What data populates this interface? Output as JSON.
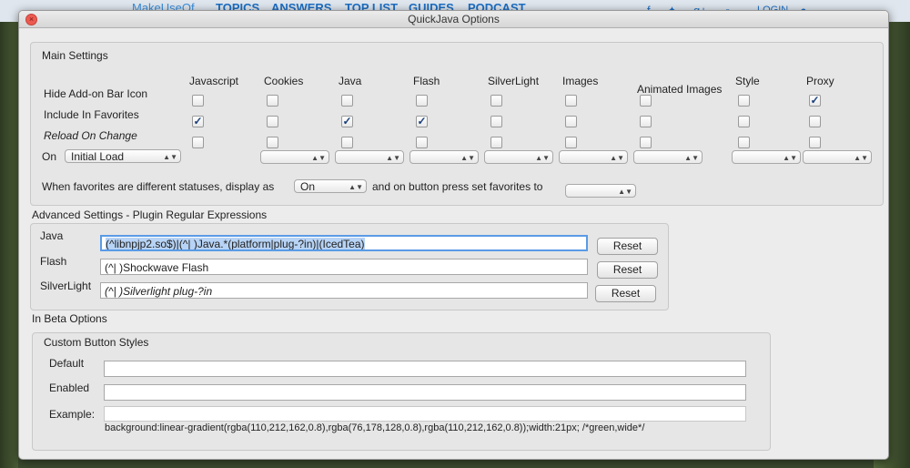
{
  "site_nav": {
    "logo": "MakeUseOf",
    "items": [
      "TOPICS",
      "ANSWERS",
      "TOP LIST",
      "GUIDES",
      "PODCAST"
    ],
    "login": "LOGIN"
  },
  "window": {
    "title": "QuickJava Options"
  },
  "main_settings": {
    "label": "Main Settings",
    "columns": [
      "Javascript",
      "Cookies",
      "Java",
      "Flash",
      "SilverLight",
      "Images",
      "Animated Images",
      "Style",
      "Proxy"
    ],
    "rows": [
      {
        "label": "Hide Add-on Bar Icon",
        "checked": [
          false,
          false,
          false,
          false,
          false,
          false,
          false,
          false,
          true
        ]
      },
      {
        "label": "Include In Favorites",
        "checked": [
          true,
          false,
          true,
          true,
          false,
          false,
          false,
          false,
          false
        ]
      },
      {
        "label": "Reload On Change",
        "checked": [
          false,
          false,
          false,
          false,
          false,
          false,
          false,
          false,
          false
        ]
      }
    ],
    "on_label": "On",
    "on_value": "Initial Load",
    "favorites_text": "When favorites are different statuses, display as",
    "favorites_value": "On",
    "button_text": "and on button press set favorites to",
    "button_value": ""
  },
  "advanced": {
    "label": "Advanced Settings - Plugin Regular Expressions",
    "rows": [
      {
        "label": "Java",
        "value": "(^libnpjp2.so$)|(^| )Java.*(platform|plug-?in)|(IcedTea)",
        "reset": "Reset"
      },
      {
        "label": "Flash",
        "value": "(^| )Shockwave Flash",
        "reset": "Reset"
      },
      {
        "label": "SilverLight",
        "value": "(^| )Silverlight plug-?in",
        "reset": "Reset"
      }
    ]
  },
  "beta": {
    "label": "In Beta Options",
    "custom_label": "Custom Button Styles",
    "rows": [
      {
        "label": "Default",
        "value": ""
      },
      {
        "label": "Enabled",
        "value": ""
      }
    ],
    "example_label": "Example:",
    "example_value": "background:linear-gradient(rgba(110,212,162,0.8),rgba(76,178,128,0.8),rgba(110,212,162,0.8));width:21px; /*green,wide*/"
  }
}
